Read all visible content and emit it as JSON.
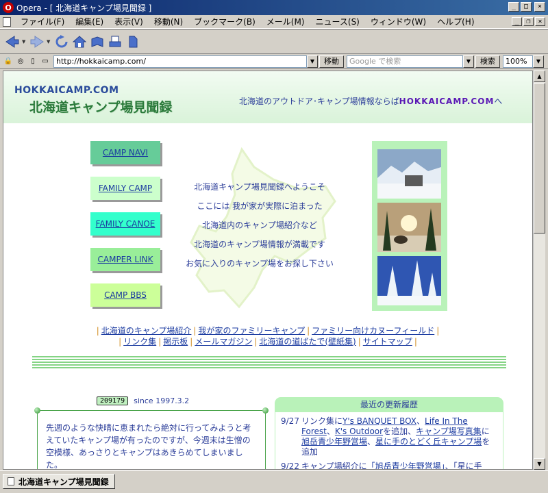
{
  "window": {
    "title": "Opera - [ 北海道キャンプ場見聞録 ]",
    "app_icon": "opera-icon"
  },
  "menu": [
    "ファイル(F)",
    "編集(E)",
    "表示(V)",
    "移動(N)",
    "ブックマーク(B)",
    "メール(M)",
    "ニュース(S)",
    "ウィンドウ(W)",
    "ヘルプ(H)"
  ],
  "address_bar": {
    "url": "http://hokkaicamp.com/",
    "go_label": "移動",
    "search_placeholder": "Google で検索",
    "search_label": "検索",
    "zoom": "100%"
  },
  "header": {
    "logo_en": "HOKKAICAMP.COM",
    "logo_jp": "北海道キャンプ場見聞録",
    "tagline_prefix": "北海道のアウトドア･キャンプ場情報ならば",
    "tagline_highlight": "HOKKAICAMP.COM",
    "tagline_suffix": "へ"
  },
  "nav_buttons": [
    {
      "label": "CAMP NAVI",
      "color": "#66cc99"
    },
    {
      "label": "FAMILY CAMP",
      "color": "#ccffcc"
    },
    {
      "label": "FAMILY CANOE",
      "color": "#33ffcc"
    },
    {
      "label": "CAMPER LINK",
      "color": "#99ee99"
    },
    {
      "label": "CAMP BBS",
      "color": "#ccff99"
    }
  ],
  "greeting": [
    "北海道キャンプ場見聞録へようこそ",
    "ここには 我が家が実際に泊まった",
    "北海道内のキャンプ場紹介など",
    "北海道のキャンプ場情報が満載です",
    "お気に入りのキャンプ場をお探し下さい"
  ],
  "links_row1": [
    "北海道のキャンプ場紹介",
    "我が家のファミリーキャンプ",
    "ファミリー向けカヌーフィールド"
  ],
  "links_row2": [
    "リンク集",
    "掲示板",
    "メールマガジン",
    "北海道の道ばたで(壁紙集)",
    "サイトマップ"
  ],
  "counter": {
    "value": "209179",
    "since": "since 1997.3.2"
  },
  "message": "先週のような快晴に恵まれたら絶対に行ってみようと考えていたキャンプ場が有ったのですが、今週末は生憎の空模様、あっさりとキャンプはあきらめてしまいました。",
  "updates": {
    "title": "最近の更新履歴",
    "entries": [
      {
        "date": "9/27",
        "t1": "リンク集に",
        "l1": "Y's BANQUET BOX",
        "t2": "、",
        "l2": "Life In The Forest",
        "t3": "、",
        "l3": "K's Outdoor",
        "t4": "を追加、",
        "l4": "キャンプ場写真集",
        "t5": "に",
        "l5": "旭岳青少年野営場",
        "t6": "、",
        "l6": "星に手のとどく丘キャンプ場",
        "t7": "を追加"
      },
      {
        "date": "9/22",
        "t1": "キャンプ場紹介に",
        "l1": "「旭岳青少年野営場」",
        "t2": "、「星に手"
      }
    ]
  },
  "status": {
    "tab_label": "北海道キャンプ場見聞録"
  }
}
